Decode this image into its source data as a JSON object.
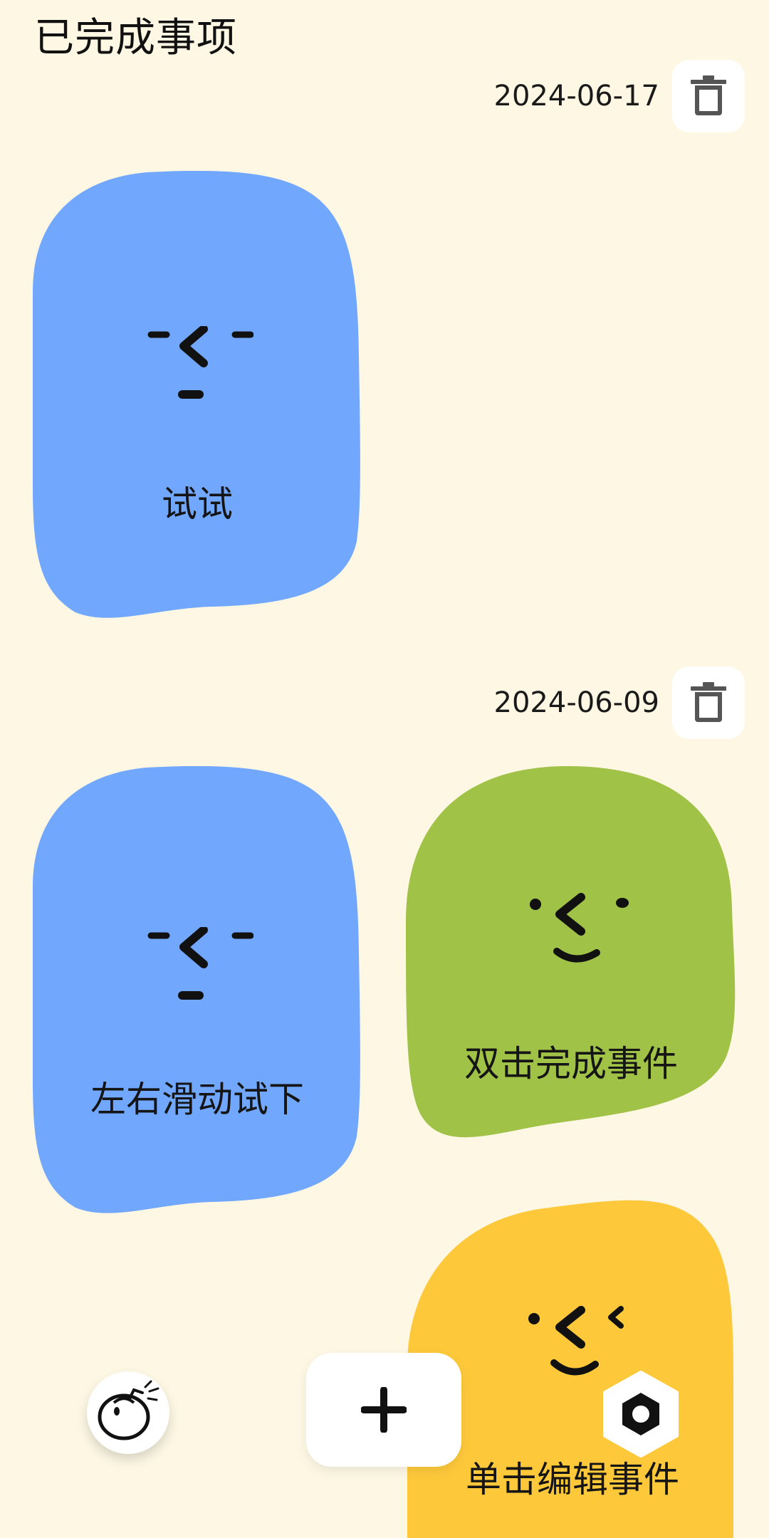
{
  "header": {
    "title": "已完成事项"
  },
  "groups": [
    {
      "date": "2024-06-17",
      "items": [
        {
          "label": "试试",
          "color": "#71a7fd",
          "mood": "neutral"
        }
      ]
    },
    {
      "date": "2024-06-09",
      "items": [
        {
          "label": "左右滑动试下",
          "color": "#71a7fd",
          "mood": "neutral"
        },
        {
          "label": "双击完成事件",
          "color": "#a0c247",
          "mood": "smile"
        },
        {
          "label": "单击编辑事件",
          "color": "#fdc93b",
          "mood": "wink"
        }
      ]
    }
  ],
  "icons": {
    "delete": "trash-icon",
    "add": "plus-icon",
    "pomodoro": "tomato-icon",
    "settings": "hex-nut-icon"
  },
  "colors": {
    "background": "#fdf7e4",
    "card_blue": "#71a7fd",
    "card_green": "#a0c247",
    "card_yellow": "#fdc93b",
    "icon_gray": "#555555"
  }
}
